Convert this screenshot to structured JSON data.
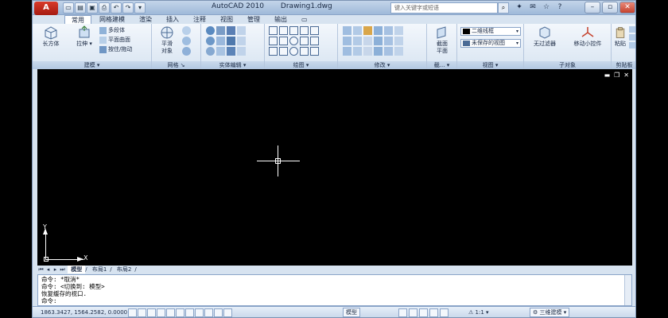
{
  "window": {
    "app_title": "AutoCAD 2010",
    "doc_title": "Drawing1.dwg",
    "search_placeholder": "键入关键字或短语"
  },
  "tabs": [
    {
      "label": "常用",
      "active": true
    },
    {
      "label": "网格建模"
    },
    {
      "label": "渲染"
    },
    {
      "label": "插入"
    },
    {
      "label": "注释"
    },
    {
      "label": "视图"
    },
    {
      "label": "管理"
    },
    {
      "label": "输出"
    }
  ],
  "panels": {
    "modeling": {
      "title": "建模",
      "box": "长方体",
      "extrude": "拉伸",
      "polysolid": "多段体",
      "planar_surface": "平面曲面",
      "presspull": "按住/拖动"
    },
    "mesh": {
      "title": "网格",
      "smooth_line1": "平滑",
      "smooth_line2": "对象"
    },
    "solid_edit": {
      "title": "实体编辑"
    },
    "draw": {
      "title": "绘图"
    },
    "modify": {
      "title": "修改"
    },
    "section": {
      "title": "截...",
      "plane_line1": "截面",
      "plane_line2": "平面"
    },
    "view": {
      "title": "视图",
      "visual_style": "二维线框",
      "saved_view": "未保存的视图"
    },
    "subobject": {
      "title": "子对象",
      "no_filter": "无过滤器",
      "move_gizmo": "移动小控件"
    },
    "clipboard": {
      "title": "剪贴板",
      "paste": "粘贴"
    }
  },
  "layout_tabs": [
    "模型",
    "布局1",
    "布局2"
  ],
  "ucs": {
    "x": "X",
    "y": "Y"
  },
  "command_lines": [
    "命令: *取消*",
    "命令:  <切换到: 模型>",
    "恢复缓存的视口.",
    "命令:"
  ],
  "status": {
    "coords": "1863.3427, 1564.2582, 0.0000",
    "model": "模型",
    "scale": "1:1",
    "workspace": "三维建模"
  },
  "colors": {
    "drawing_bg": "#000000",
    "ribbon_bg": "#dbe6f3",
    "accent": "#c5422d"
  }
}
